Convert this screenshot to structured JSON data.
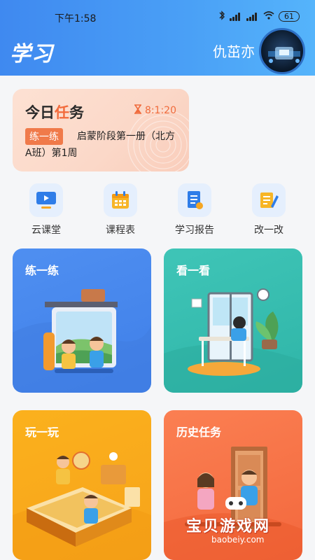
{
  "status_bar": {
    "time": "下午1:58",
    "battery": "61"
  },
  "header": {
    "title": "学习",
    "user_name": "仇茁亦"
  },
  "task_card": {
    "title_prefix": "今日",
    "title_accent": "任",
    "title_suffix": "务",
    "timer": "8:1:20",
    "tag": "练一练",
    "description": "启蒙阶段第一册（北方A班）第1周"
  },
  "quick_nav": [
    {
      "label": "云课堂",
      "icon": "video-icon"
    },
    {
      "label": "课程表",
      "icon": "calendar-icon"
    },
    {
      "label": "学习报告",
      "icon": "report-icon"
    },
    {
      "label": "改一改",
      "icon": "edit-icon"
    }
  ],
  "tiles": [
    {
      "label": "练一练",
      "color": "#4f8ff1"
    },
    {
      "label": "看一看",
      "color": "#3fc5b7"
    },
    {
      "label": "玩一玩",
      "color": "#fbb11d"
    },
    {
      "label": "历史任务",
      "color": "#fb7f52"
    }
  ],
  "watermark": {
    "main": "宝贝游戏网",
    "sub": "baobeiy.com"
  }
}
